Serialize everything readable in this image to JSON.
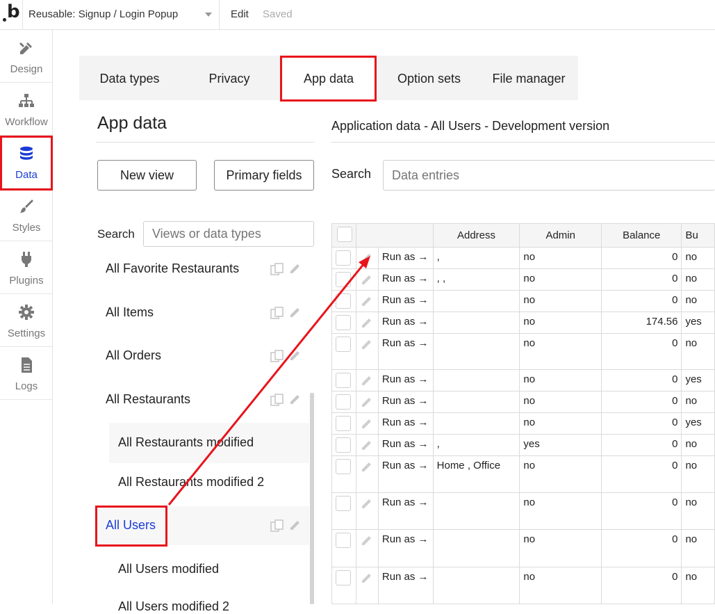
{
  "topbar": {
    "page_name": "Reusable: Signup / Login Popup",
    "edit_label": "Edit",
    "saved_label": "Saved"
  },
  "leftnav": [
    {
      "label": "Design",
      "icon": "design-icon"
    },
    {
      "label": "Workflow",
      "icon": "workflow-icon"
    },
    {
      "label": "Data",
      "icon": "database-icon",
      "active": true
    },
    {
      "label": "Styles",
      "icon": "brush-icon"
    },
    {
      "label": "Plugins",
      "icon": "plug-icon"
    },
    {
      "label": "Settings",
      "icon": "gear-icon"
    },
    {
      "label": "Logs",
      "icon": "document-icon"
    }
  ],
  "tabs": [
    "Data types",
    "Privacy",
    "App data",
    "Option sets",
    "File manager"
  ],
  "active_tab": "App data",
  "section_title": "App data",
  "buttons": {
    "new_view": "New view",
    "primary_fields": "Primary fields"
  },
  "views_search": {
    "label": "Search",
    "placeholder": "Views or data types"
  },
  "views": [
    {
      "label": "All Favorite Restaurants"
    },
    {
      "label": "All Items"
    },
    {
      "label": "All Orders"
    },
    {
      "label": "All Restaurants"
    },
    {
      "label": "All Restaurants modified",
      "sub": true
    },
    {
      "label": "All Restaurants modified 2",
      "sub": true
    },
    {
      "label": "All Users",
      "active": true
    },
    {
      "label": "All Users modified",
      "sub": true
    },
    {
      "label": "All Users modified 2",
      "sub": true
    }
  ],
  "application_heading": "Application data - All Users - Development version",
  "entries_search": {
    "label": "Search",
    "placeholder": "Data entries"
  },
  "table": {
    "columns": [
      "",
      "",
      "Address",
      "Admin",
      "Balance",
      "Bu"
    ],
    "run_as_label": "Run as →",
    "rows": [
      {
        "address": ",",
        "admin": "no",
        "balance": "0",
        "bu": "no"
      },
      {
        "address": ", ,",
        "admin": "no",
        "balance": "0",
        "bu": "no"
      },
      {
        "address": "",
        "admin": "no",
        "balance": "0",
        "bu": "no"
      },
      {
        "address": "",
        "admin": "no",
        "balance": "174.56",
        "bu": "yes"
      },
      {
        "address": "",
        "admin": "no",
        "balance": "0",
        "bu": "no"
      },
      {
        "address": "",
        "admin": "no",
        "balance": "0",
        "bu": "yes"
      },
      {
        "address": "",
        "admin": "no",
        "balance": "0",
        "bu": "no"
      },
      {
        "address": "",
        "admin": "no",
        "balance": "0",
        "bu": "yes"
      },
      {
        "address": ",",
        "admin": "yes",
        "balance": "0",
        "bu": "no"
      },
      {
        "address": "Home , Office",
        "admin": "no",
        "balance": "0",
        "bu": "no"
      },
      {
        "address": "",
        "admin": "no",
        "balance": "0",
        "bu": "no"
      },
      {
        "address": "",
        "admin": "no",
        "balance": "0",
        "bu": "no"
      },
      {
        "address": "",
        "admin": "no",
        "balance": "0",
        "bu": "no"
      },
      {
        "address": "",
        "admin": "",
        "balance": "0",
        "bu": ""
      }
    ]
  },
  "colors": {
    "accent": "#1a3cd6",
    "highlight": "#e8141c",
    "tab_bg": "#f3f3f3"
  }
}
